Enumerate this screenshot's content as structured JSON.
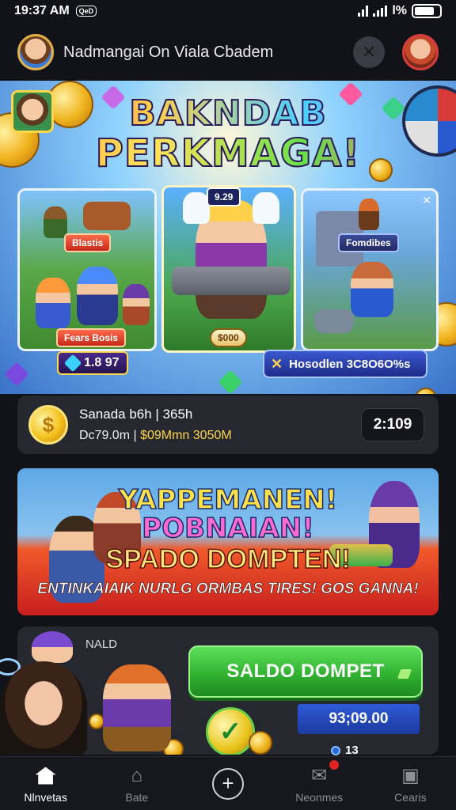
{
  "status_bar": {
    "time": "19:37 AM",
    "notif_chip": "QeD",
    "signal_text": "l%"
  },
  "header": {
    "title": "Nadmangai On Viala Cbadem",
    "close_icon": "x-icon"
  },
  "hero": {
    "title_line1": "BAKNDAB",
    "title_line2": "PERKMAGA!",
    "card_left_tag": "Blastis",
    "card_left_footer": "Fears Bosis",
    "card_mid_tag": "9.29",
    "card_mid_footer": "$000",
    "card_right_tag": "Fomdibes",
    "price_badge": "1.8 97",
    "promo_badge": "Hosodlen 3C8O6O%s"
  },
  "wallet": {
    "title": "Sanada b6h | 365h",
    "detail_prefix": "Dc79.0m | ",
    "detail_highlight": "$09Mmn 3050M",
    "timer": "2:109"
  },
  "promo_banner": {
    "title1": "YAPPEMANEN!",
    "title2": "POBNAIAN!",
    "cta": "SPADO DOMPTEN!",
    "subtitle": "ENTINKAIAIK NURLG ORMBAS TIRES! GOS GANNA!"
  },
  "bottom_card": {
    "label": "NALD",
    "button": "SALDO DOMPET",
    "balance": "93;09.00",
    "count": "13"
  },
  "nav": {
    "items": [
      {
        "label": "Nlnvetas",
        "icon": "home-icon"
      },
      {
        "label": "Bate",
        "icon": "shop-icon"
      },
      {
        "label": "",
        "icon": "plus-icon"
      },
      {
        "label": "Neonmes",
        "icon": "notification-icon"
      },
      {
        "label": "Cearis",
        "icon": "cart-icon"
      }
    ]
  },
  "colors": {
    "background": "#121318",
    "card": "#262830",
    "accent_green": "#2fae2f",
    "accent_blue": "#2e5ad8",
    "accent_gold": "#ffd54a"
  }
}
